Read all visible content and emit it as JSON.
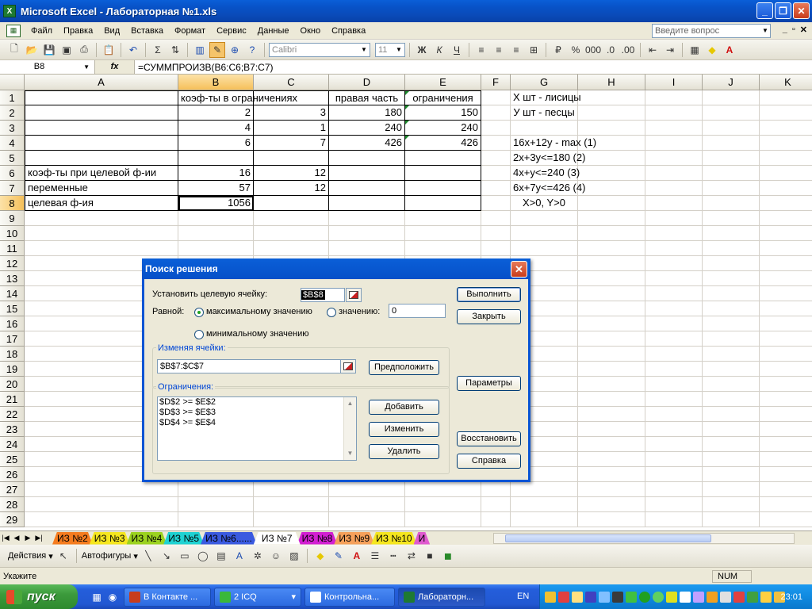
{
  "window": {
    "title": "Microsoft Excel - Лабораторная №1.xls",
    "min": "_",
    "max": "❐",
    "close": "✕"
  },
  "menu": {
    "items": [
      "Файл",
      "Правка",
      "Вид",
      "Вставка",
      "Формат",
      "Сервис",
      "Данные",
      "Окно",
      "Справка"
    ],
    "help_placeholder": "Введите вопрос",
    "mdi_min": "_",
    "mdi_restore": "▫",
    "mdi_close": "✕"
  },
  "toolbar": {
    "font": "Calibri",
    "size": "11",
    "bold": "Ж",
    "italic": "К",
    "underline": "Ч"
  },
  "formula_bar": {
    "name_box": "B8",
    "fx": "fx",
    "formula": "=СУММПРОИЗВ(B6:C6;B7:C7)"
  },
  "columns": [
    "A",
    "B",
    "C",
    "D",
    "E",
    "F",
    "G",
    "H",
    "I",
    "J",
    "K"
  ],
  "rows": [
    [
      "",
      "коэф-ты в ограничениях",
      "",
      "правая часть",
      "ограничения",
      "",
      "X шт - лисицы",
      "",
      "",
      "",
      ""
    ],
    [
      "",
      "2",
      "3",
      "180",
      "150",
      "",
      "У шт - песцы",
      "",
      "",
      "",
      ""
    ],
    [
      "",
      "4",
      "1",
      "240",
      "240",
      "",
      "",
      "",
      "",
      "",
      ""
    ],
    [
      "",
      "6",
      "7",
      "426",
      "426",
      "",
      "16x+12y - max   (1)",
      "",
      "",
      "",
      ""
    ],
    [
      "",
      "",
      "",
      "",
      "",
      "",
      "2x+3y<=180   (2)",
      "",
      "",
      "",
      ""
    ],
    [
      "коэф-ты при целевой ф-ии",
      "16",
      "12",
      "",
      "",
      "",
      "4x+y<=240   (3)",
      "",
      "",
      "",
      ""
    ],
    [
      "переменные",
      "57",
      "12",
      "",
      "",
      "",
      "6x+7y<=426   (4)",
      "",
      "",
      "",
      ""
    ],
    [
      "целевая ф-ия",
      "1056",
      "",
      "",
      "",
      "",
      "X>0, Y>0",
      "",
      "",
      "",
      ""
    ]
  ],
  "row_numbers": [
    "1",
    "2",
    "3",
    "4",
    "5",
    "6",
    "7",
    "8",
    "9",
    "10",
    "11",
    "12",
    "13",
    "14",
    "15",
    "16",
    "17",
    "18",
    "19",
    "20",
    "21",
    "22",
    "23",
    "24",
    "25",
    "26",
    "27",
    "28",
    "29"
  ],
  "sheets": {
    "tabs": [
      {
        "label": "ИЗ №2",
        "color": "#f57c1f"
      },
      {
        "label": "ИЗ №3",
        "color": "#f5e61f"
      },
      {
        "label": "ИЗ №4",
        "color": "#9bd21f"
      },
      {
        "label": "ИЗ №5",
        "color": "#1fd2d2"
      },
      {
        "label": "ИЗ №6......",
        "color": "#3a5ae0"
      },
      {
        "label": "ИЗ №7",
        "color": "#ffffff"
      },
      {
        "label": "ИЗ №8",
        "color": "#d21fd2"
      },
      {
        "label": "ИЗ №9",
        "color": "#f5a05a"
      },
      {
        "label": "ИЗ №10",
        "color": "#f5e61f"
      },
      {
        "label": "И",
        "color": "#e05ad0"
      }
    ]
  },
  "drawing": {
    "actions": "Действия",
    "autoshapes": "Автофигуры"
  },
  "status": {
    "text": "Укажите",
    "num": "NUM"
  },
  "taskbar": {
    "start": "пуск",
    "buttons": [
      "В Контакте ...",
      "2 ICQ",
      "Контрольна...",
      "Лабораторн..."
    ],
    "lang": "EN",
    "clock": "23:01"
  },
  "dialog": {
    "title": "Поиск решения",
    "target_label": "Установить целевую ячейку:",
    "target_value": "$B$8",
    "equal_label": "Равной:",
    "opt_max": "максимальному значению",
    "opt_value": "значению:",
    "value_input": "0",
    "opt_min": "минимальному значению",
    "changing_label": "Изменяя ячейки:",
    "changing_value": "$B$7:$C$7",
    "guess_button": "Предположить",
    "constraints_label": "Ограничения:",
    "constraints": [
      "$D$2 >= $E$2",
      "$D$3 >= $E$3",
      "$D$4 >= $E$4"
    ],
    "add_button": "Добавить",
    "change_button": "Изменить",
    "delete_button": "Удалить",
    "solve_button": "Выполнить",
    "close_button": "Закрыть",
    "options_button": "Параметры",
    "reset_button": "Восстановить",
    "help_button": "Справка",
    "close_x": "✕"
  }
}
